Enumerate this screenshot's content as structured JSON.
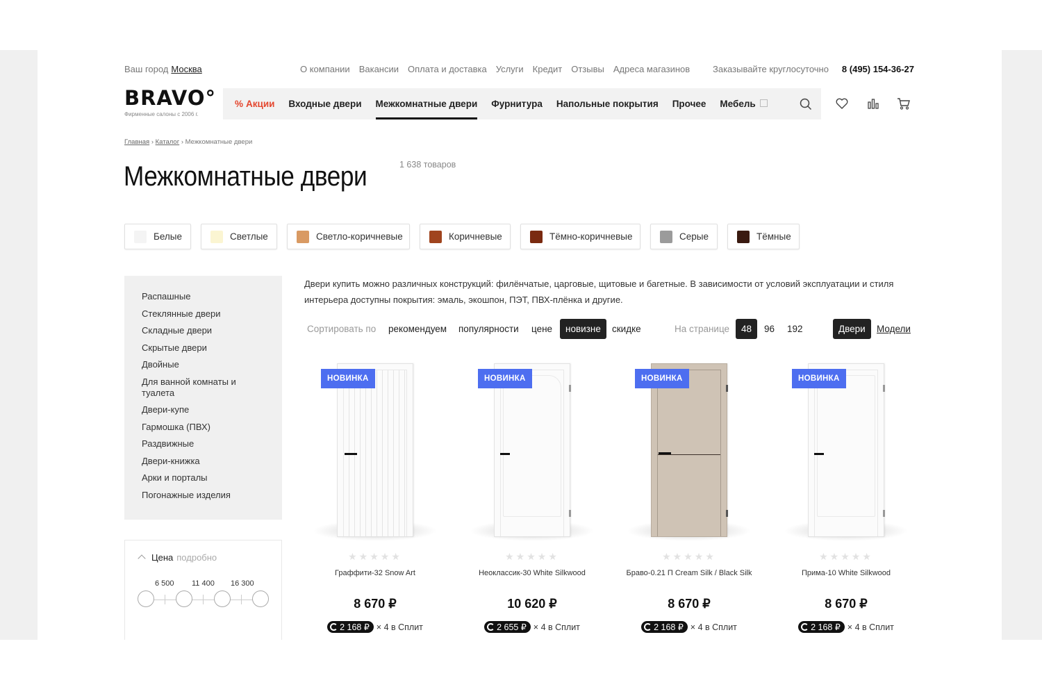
{
  "colors": {
    "accent": "#e4462e",
    "badge": "#4d6ef0",
    "pill": "#222222",
    "sidebar_bg": "#f0f0f0"
  },
  "topbar": {
    "city_label": "Ваш город",
    "city_value": "Москва",
    "links": [
      "О компании",
      "Вакансии",
      "Оплата и доставка",
      "Услуги",
      "Кредит",
      "Отзывы",
      "Адреса магазинов"
    ],
    "phone_note": "Заказывайте круглосуточно",
    "phone": "8 (495) 154-36-27"
  },
  "header": {
    "logo_text": "BRAVO°",
    "logo_sub": "Фирменные салоны с 2006 г.",
    "nav": [
      "Акции",
      "Входные двери",
      "Межкомнатные двери",
      "Фурнитура",
      "Напольные покрытия",
      "Прочее",
      "Мебель"
    ],
    "promo_sign": "%",
    "icons": [
      "search-icon",
      "heart-icon",
      "compare-icon",
      "cart-icon"
    ]
  },
  "breadcrumbs": {
    "home": "Главная",
    "sep": "›",
    "catalog": "Каталог",
    "current": "Межкомнатные двери"
  },
  "page": {
    "title": "Межкомнатные двери",
    "count": "1 638 товаров"
  },
  "color_filters": [
    {
      "label": "Белые",
      "color": "#f4f4f4"
    },
    {
      "label": "Светлые",
      "color": "#fbf5d2"
    },
    {
      "label": "Светло-коричневые",
      "color": "#d99a63"
    },
    {
      "label": "Коричневые",
      "color": "#a0441e"
    },
    {
      "label": "Тёмно-коричневые",
      "color": "#7a2a10"
    },
    {
      "label": "Серые",
      "color": "#9b9b9b"
    },
    {
      "label": "Тёмные",
      "color": "#3a1a10"
    }
  ],
  "sidebar": {
    "items": [
      "Распашные",
      "Стеклянные двери",
      "Складные двери",
      "Скрытые двери",
      "Двойные",
      "Для ванной комнаты и туалета",
      "Двери-купе",
      "Гармошка (ПВХ)",
      "Раздвижные",
      "Двери-книжка",
      "Арки и порталы",
      "Погонажные изделия"
    ]
  },
  "price_filter": {
    "label": "Цена",
    "detail": "подробно",
    "values": [
      "6 500",
      "11 400",
      "16 300"
    ]
  },
  "description": "Двери купить можно различных конструкций: филёнчатые, царговые, щитовые и багетные. В зависимости от условий эксплуатации и стиля интерьера доступны покрытия: эмаль, экошпон, ПЭТ, ПВХ-плёнка и другие.",
  "sort": {
    "label": "Сортировать по",
    "options": [
      "рекомендуем",
      "популярности",
      "цене",
      "новизне",
      "скидке"
    ],
    "active": "новизне",
    "per_page_label": "На странице",
    "per_page": [
      "48",
      "96",
      "192"
    ],
    "per_page_active": "48",
    "view": [
      "Двери",
      "Модели"
    ],
    "view_active": "Двери"
  },
  "products": [
    {
      "badge": "НОВИНКА",
      "stars": "★★★★★",
      "name": "Граффити-32 Snow Art",
      "price": "8 670 ₽",
      "split_amount": "2 168 ₽",
      "split_text": "× 4 в Сплит",
      "door_color": "#fbfbfb"
    },
    {
      "badge": "НОВИНКА",
      "stars": "★★★★★",
      "name": "Неоклассик-30 White Silkwood",
      "price": "10 620 ₽",
      "split_amount": "2 655 ₽",
      "split_text": "× 4 в Сплит",
      "door_color": "#fbfbfb"
    },
    {
      "badge": "НОВИНКА",
      "stars": "★★★★★",
      "name": "Браво-0.21 П Cream Silk / Black Silk",
      "price": "8 670 ₽",
      "split_amount": "2 168 ₽",
      "split_text": "× 4 в Сплит",
      "door_color": "#cfc3b5"
    },
    {
      "badge": "НОВИНКА",
      "stars": "★★★★★",
      "name": "Прима-10 White Silkwood",
      "price": "8 670 ₽",
      "split_amount": "2 168 ₽",
      "split_text": "× 4 в Сплит",
      "door_color": "#fbfbfb"
    }
  ]
}
